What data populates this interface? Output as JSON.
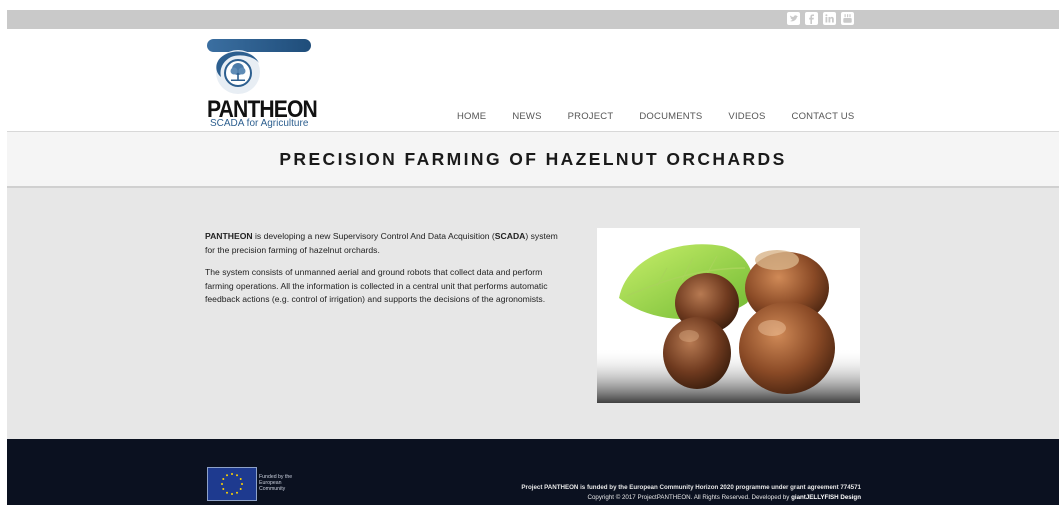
{
  "brand": {
    "name": "PANTHEON",
    "tagline": "SCADA for Agriculture",
    "colors": {
      "blue": "#2d5f8f",
      "accent_dark": "#0b1120"
    }
  },
  "social": [
    {
      "icon": "twitter-icon"
    },
    {
      "icon": "facebook-icon"
    },
    {
      "icon": "linkedin-icon"
    },
    {
      "icon": "youtube-icon"
    }
  ],
  "nav": {
    "items": [
      "HOME",
      "NEWS",
      "PROJECT",
      "DOCUMENTS",
      "VIDEOS",
      "CONTACT US"
    ]
  },
  "page_title": "PRECISION FARMING OF HAZELNUT ORCHARDS",
  "intro": {
    "p1_bold": "PANTHEON",
    "p1_a": " is developing a new Supervisory Control And Data Acquisition (",
    "p1_bold2": "SCADA",
    "p1_b": ") system for the precision farming of hazelnut orchards.",
    "p2": "The system consists of unmanned aerial and ground robots that collect data and perform farming operations. All the information is collected in a central unit that performs automatic feedback actions (e.g. control of irrigation) and supports the decisions of the agronomists."
  },
  "footer": {
    "eu_text": "Funded by the European Community",
    "funding_line": "Project PANTHEON is funded by the European Community Horizon 2020 programme under grant agreement 774571",
    "copyright_pre": "Copyright © 2017 ProjectPANTHEON. All Rights Reserved. Developed by ",
    "developer": "giantJELLYFISH Design"
  }
}
